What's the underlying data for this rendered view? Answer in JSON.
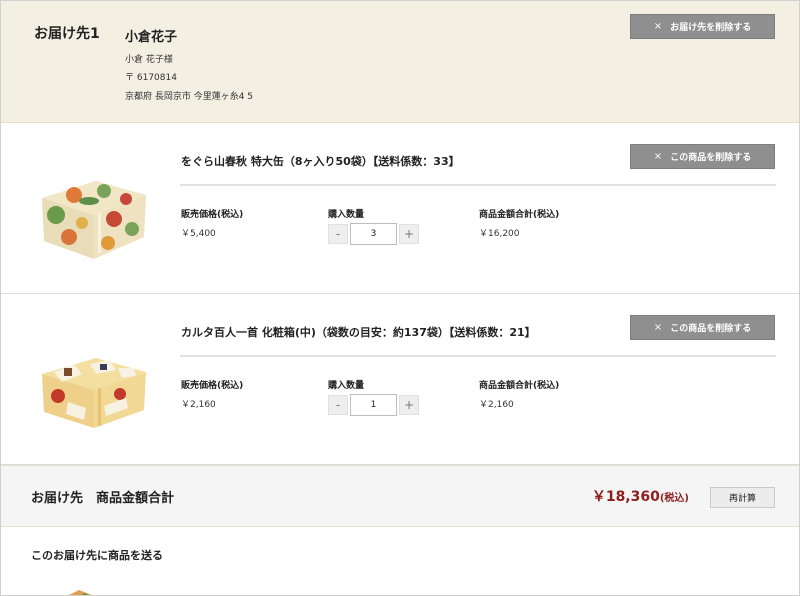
{
  "address": {
    "title": "お届け先1",
    "name": "小倉花子",
    "recipient": "小倉 花子様",
    "postal": "〒 6170814",
    "location": "京都府 長岡京市 今里蓮ヶ糸4 5",
    "delete_label": "お届け先を削除する"
  },
  "items": [
    {
      "title": "をぐら山春秋 特大缶（8ヶ入り50袋）【送料係数：33】",
      "delete_label": "この商品を削除する",
      "price_label": "販売価格(税込)",
      "price": "￥5,400",
      "qty_label": "購入数量",
      "qty": "3",
      "subtotal_label": "商品金額合計(税込)",
      "subtotal": "￥16,200"
    },
    {
      "title": "カルタ百人一首 化粧箱(中)（袋数の目安：約137袋）【送料係数：21】",
      "delete_label": "この商品を削除する",
      "price_label": "販売価格(税込)",
      "price": "￥2,160",
      "qty_label": "購入数量",
      "qty": "1",
      "subtotal_label": "商品金額合計(税込)",
      "subtotal": "￥2,160"
    }
  ],
  "stepper": {
    "minus": "-",
    "plus": "+"
  },
  "delete_glyph": "×",
  "totals": {
    "label": "お届け先　商品金額合計",
    "amount": "￥18,360",
    "tax_note": "(税込)",
    "recalc_label": "再計算"
  },
  "send_heading": "このお届け先に商品を送る",
  "colors": {
    "address_bg": "#f3efe3",
    "button_gray": "#8f8f8f",
    "total_red": "#8b1e1e"
  }
}
